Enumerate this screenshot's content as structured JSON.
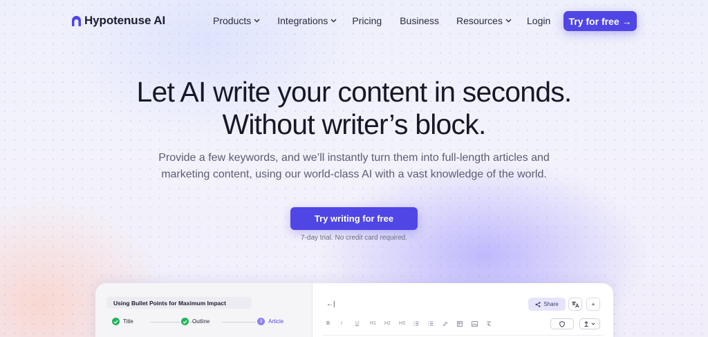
{
  "brand": {
    "name": "Hypotenuse AI",
    "accent": "#5046e5"
  },
  "nav": {
    "items": [
      {
        "label": "Products",
        "dropdown": true
      },
      {
        "label": "Integrations",
        "dropdown": true
      },
      {
        "label": "Pricing",
        "dropdown": false
      },
      {
        "label": "Business",
        "dropdown": false
      },
      {
        "label": "Resources",
        "dropdown": true
      }
    ],
    "login": "Login",
    "cta": "Try for free →"
  },
  "hero": {
    "title_line1": "Let AI write your content in seconds.",
    "title_line2": "Without writer’s block.",
    "subtitle_line1": "Provide a few keywords, and we’ll instantly turn them into full-length articles and",
    "subtitle_line2": "marketing content, using our world-class AI with a vast knowledge of the world.",
    "cta": "Try writing for free",
    "note": "7-day trial. No credit card required."
  },
  "preview": {
    "doc_title": "Using Bullet Points for Maximum Impact",
    "steps": [
      {
        "label": "Title",
        "state": "done"
      },
      {
        "label": "Outline",
        "state": "done"
      },
      {
        "label": "Article",
        "state": "current",
        "number": "3"
      }
    ],
    "back_icon": "←|",
    "share_label": "Share",
    "translate_icon": "translate-icon",
    "add_icon": "+",
    "toolbar": [
      "B",
      "I",
      "U",
      "H1",
      "H2",
      "H3",
      "list-icon",
      "numbered-list-icon",
      "link-icon",
      "table-icon",
      "image-icon",
      "clear-format-icon"
    ],
    "shield_icon": "shield-icon",
    "export_icon": "export-icon"
  }
}
